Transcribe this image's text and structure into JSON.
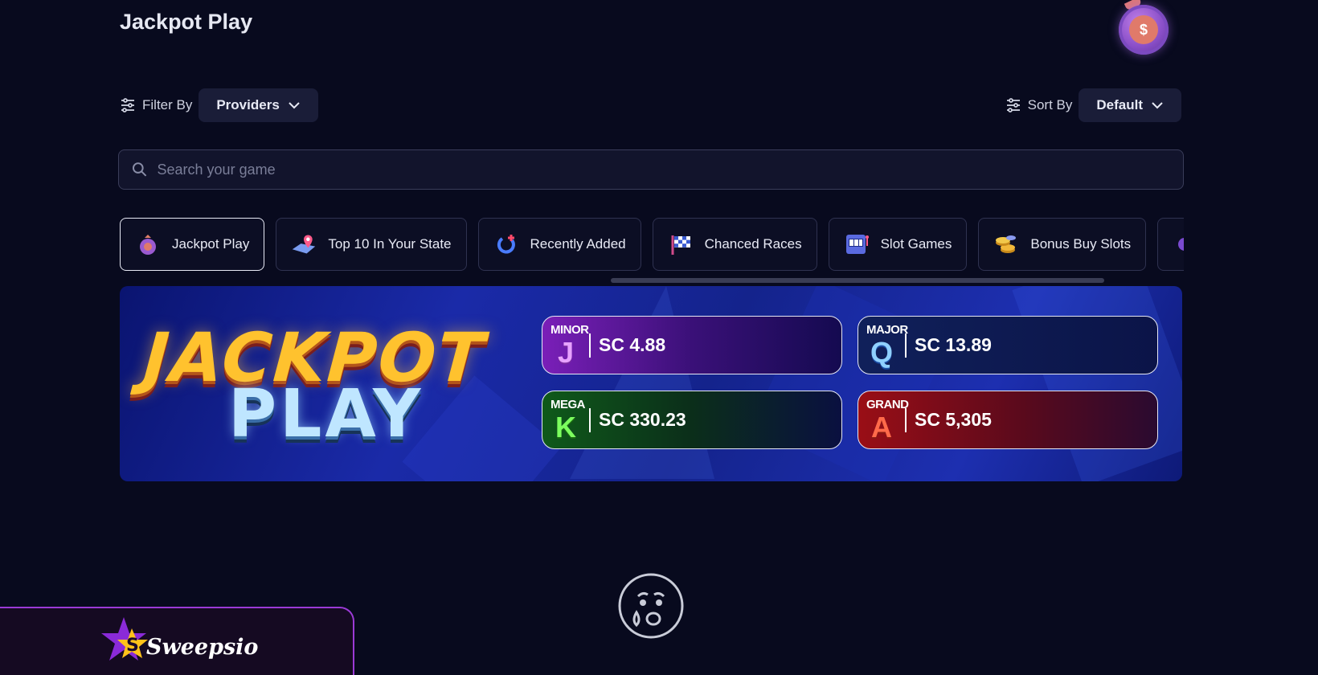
{
  "header": {
    "title": "Jackpot Play"
  },
  "filter": {
    "label": "Filter By",
    "value": "Providers"
  },
  "sort": {
    "label": "Sort By",
    "value": "Default"
  },
  "search": {
    "placeholder": "Search your game"
  },
  "categories": [
    {
      "label": "Jackpot Play",
      "icon": "money-bag-icon",
      "active": true
    },
    {
      "label": "Top 10 In Your State",
      "icon": "map-pin-icon",
      "active": false
    },
    {
      "label": "Recently Added",
      "icon": "refresh-add-icon",
      "active": false
    },
    {
      "label": "Chanced Races",
      "icon": "checkered-flag-icon",
      "active": false
    },
    {
      "label": "Slot Games",
      "icon": "slot-machine-icon",
      "active": false
    },
    {
      "label": "Bonus Buy Slots",
      "icon": "coins-icon",
      "active": false
    }
  ],
  "banner": {
    "logo_line1": "JACKPOT",
    "logo_line2": "PLAY",
    "jackpots": [
      {
        "tier": "MINOR",
        "letter": "J",
        "amount": "SC 4.88"
      },
      {
        "tier": "MAJOR",
        "letter": "Q",
        "amount": "SC 13.89"
      },
      {
        "tier": "MEGA",
        "letter": "K",
        "amount": "SC 330.23"
      },
      {
        "tier": "GRAND",
        "letter": "A",
        "amount": "SC 5,305"
      }
    ]
  },
  "brand": {
    "name": "Sweepsio",
    "star_mark": "S"
  },
  "colors": {
    "background": "#080a1e",
    "accent": "#9b3ad6",
    "chip": "#1a1d38"
  }
}
